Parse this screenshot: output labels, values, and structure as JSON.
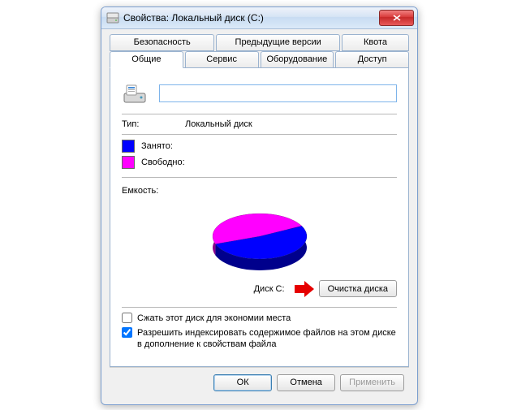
{
  "window": {
    "title": "Свойства: Локальный диск (C:)"
  },
  "tabs_top": {
    "security": "Безопасность",
    "previous": "Предыдущие версии",
    "quota": "Квота"
  },
  "tabs_bottom": {
    "general": "Общие",
    "service": "Сервис",
    "hardware": "Оборудование",
    "access": "Доступ"
  },
  "general": {
    "volume_name": "",
    "type_label": "Тип:",
    "type_value": "Локальный диск",
    "used_label": "Занято:",
    "free_label": "Свободно:",
    "capacity_label": "Емкость:",
    "disk_caption": "Диск C:",
    "cleanup_btn": "Очистка диска",
    "compress_label": "Сжать этот диск для экономии места",
    "compress_checked": false,
    "index_label": "Разрешить индексировать содержимое файлов на этом диске в дополнение к свойствам файла",
    "index_checked": true
  },
  "colors": {
    "used": "#0000ff",
    "free": "#ff00ff"
  },
  "chart_data": {
    "type": "pie",
    "title": "Диск C:",
    "series": [
      {
        "name": "Занято",
        "value": 52,
        "color": "#0000ff"
      },
      {
        "name": "Свободно",
        "value": 48,
        "color": "#ff00ff"
      }
    ]
  },
  "buttons": {
    "ok": "ОК",
    "cancel": "Отмена",
    "apply": "Применить"
  }
}
